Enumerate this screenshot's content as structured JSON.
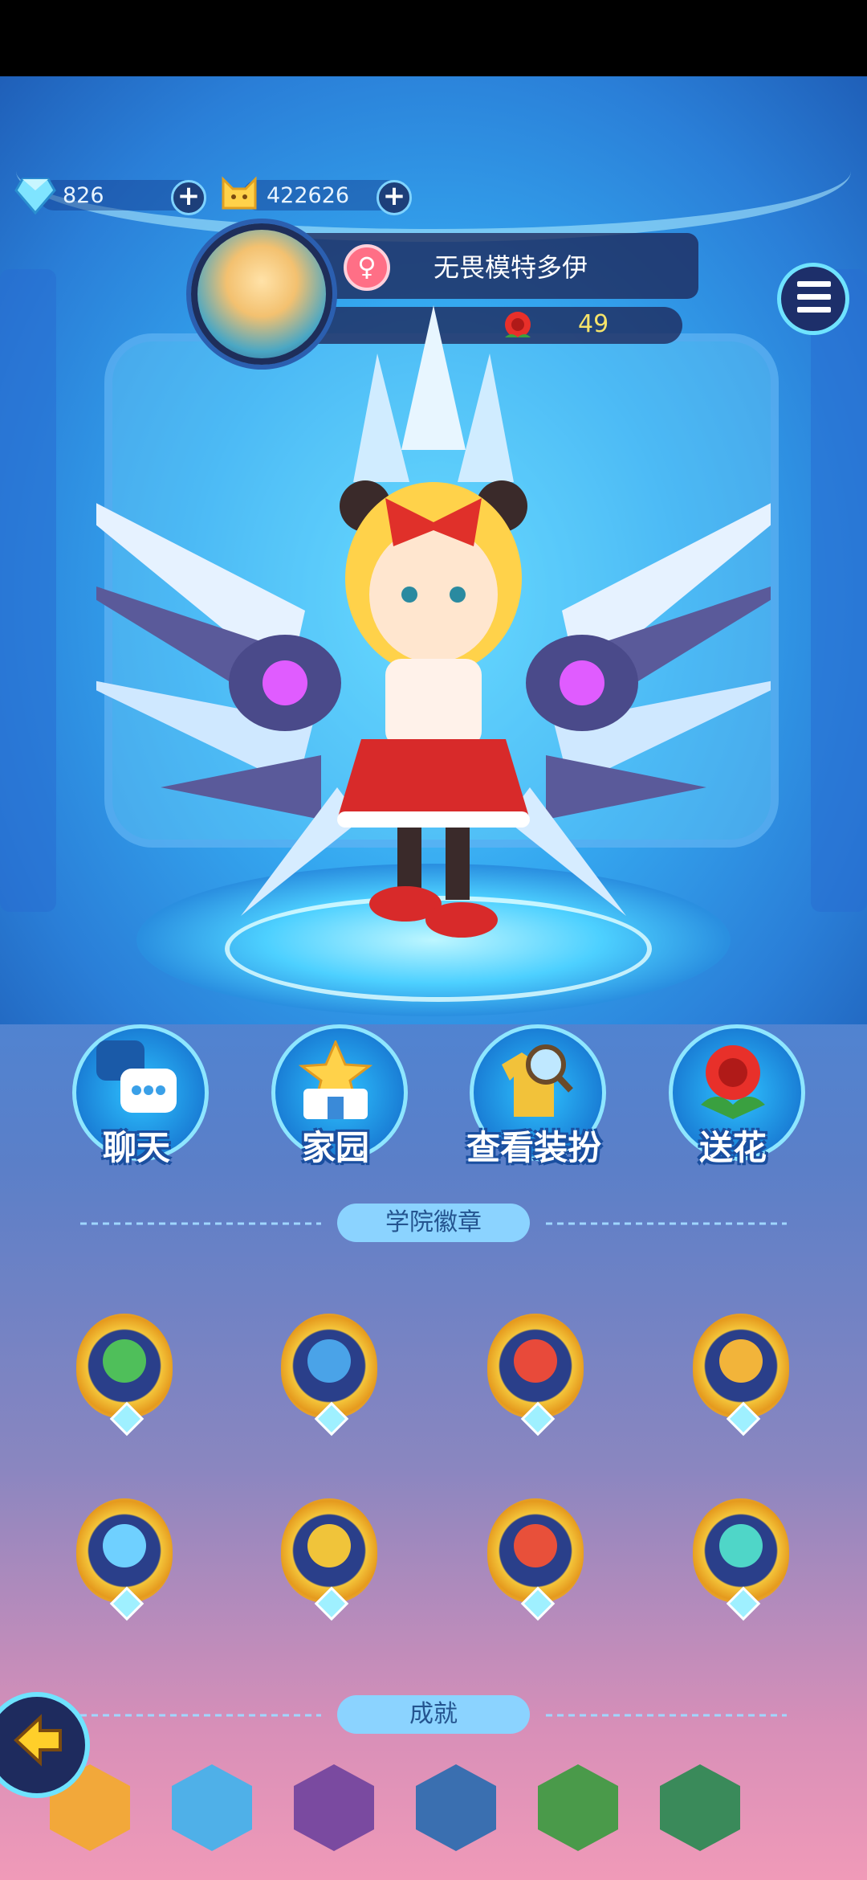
{
  "currency": {
    "diamond": {
      "icon": "diamond-icon",
      "value": "826"
    },
    "coin": {
      "icon": "cat-coin-icon",
      "value": "422626"
    }
  },
  "profile": {
    "name": "无畏模特多伊",
    "gender_symbol": "♀",
    "flowers": "49"
  },
  "actions": [
    {
      "label": "聊天",
      "icon": "chat-icon"
    },
    {
      "label": "家园",
      "icon": "home-icon"
    },
    {
      "label": "查看装扮",
      "icon": "outfit-magnifier-icon"
    },
    {
      "label": "送花",
      "icon": "rose-icon"
    }
  ],
  "sections": {
    "badges_title": "学院徽章",
    "achievements_title": "成就"
  },
  "badges": [
    {
      "name": "leaf-badge",
      "color": "#4fbf5a"
    },
    {
      "name": "vortex-badge",
      "color": "#4aa3e8"
    },
    {
      "name": "fire-badge",
      "color": "#e84a3a"
    },
    {
      "name": "sun-badge",
      "color": "#f2b43a"
    },
    {
      "name": "snowflake-badge",
      "color": "#6fd0ff"
    },
    {
      "name": "thunder-badge",
      "color": "#f0c43a"
    },
    {
      "name": "flame-beast-badge",
      "color": "#e8503a"
    },
    {
      "name": "wing-badge",
      "color": "#4fd6c8"
    }
  ],
  "achievements": [
    {
      "name": "pet-achievement",
      "color": "#f2a83a"
    },
    {
      "name": "star-achievement",
      "color": "#4fb0e8"
    },
    {
      "name": "dice-achievement",
      "color": "#7a4aa0"
    },
    {
      "name": "penguin-achievement",
      "color": "#3a6fb0"
    },
    {
      "name": "bunny-achievement",
      "color": "#4a9a4a"
    },
    {
      "name": "fruit-achievement",
      "color": "#3a8a5a"
    }
  ]
}
